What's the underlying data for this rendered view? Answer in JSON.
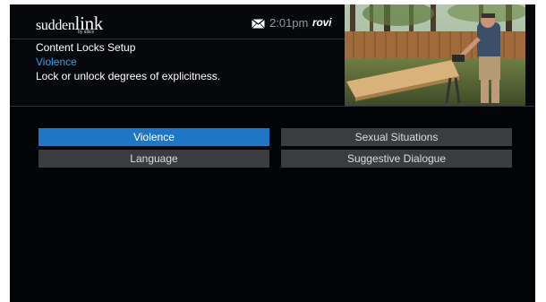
{
  "header": {
    "logo_text": "suddenlink",
    "logo_sub": "by altice",
    "time": "2:01pm",
    "brand": "rovi",
    "mail_icon": "envelope-icon"
  },
  "page": {
    "title": "Content Locks Setup",
    "subtitle": "Violence",
    "description": "Lock or unlock degrees of explicitness."
  },
  "preview": {
    "description": "live-tv-preview"
  },
  "options": [
    {
      "label": "Violence",
      "selected": true
    },
    {
      "label": "Sexual Situations",
      "selected": false
    },
    {
      "label": "Language",
      "selected": false
    },
    {
      "label": "Suggestive Dialogue",
      "selected": false
    }
  ],
  "colors": {
    "accent": "#1e76c5",
    "subtitle": "#35a0ea",
    "button": "#3a3d40",
    "background": "#020305"
  }
}
